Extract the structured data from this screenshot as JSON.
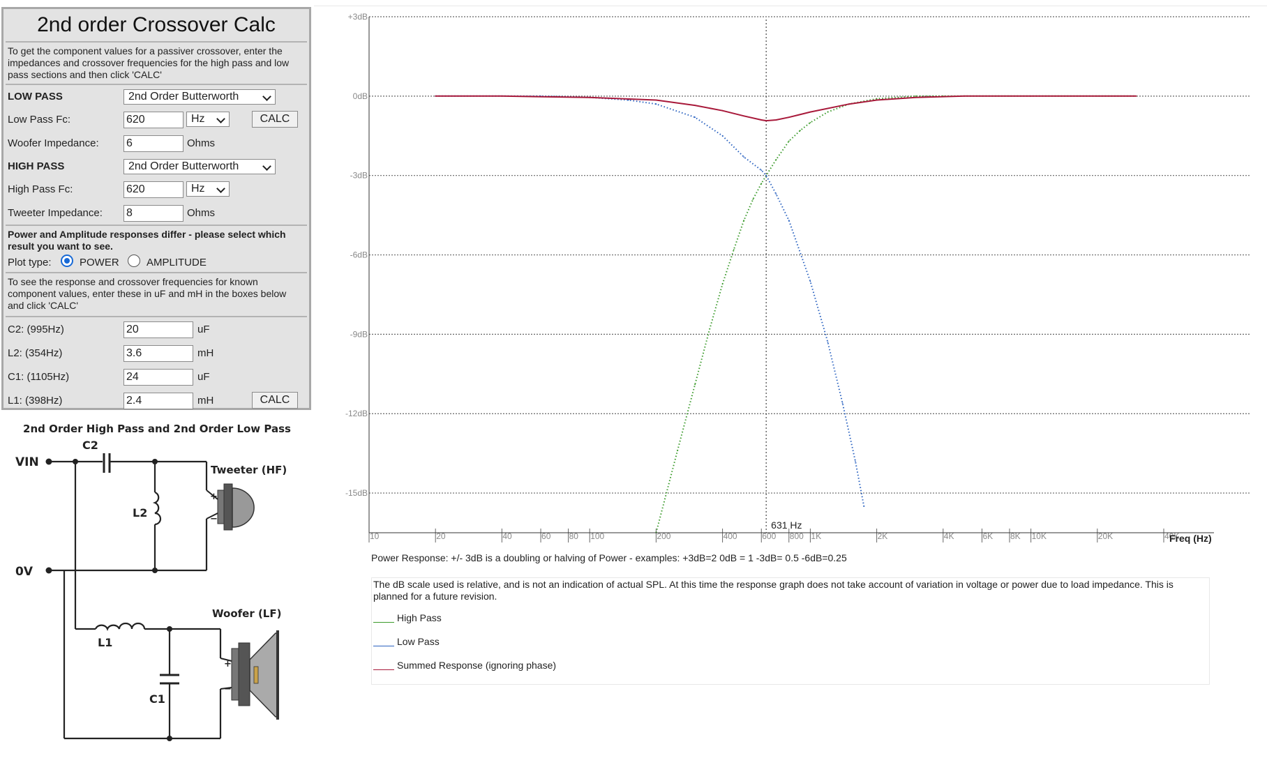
{
  "panel": {
    "title": "2nd order Crossover Calc",
    "intro": "To get the component values for a passiver crossover, enter the impedances and crossover frequencies for the high pass and low pass sections and then click 'CALC'",
    "low_pass": {
      "heading": "LOW PASS",
      "filter_type": "2nd Order Butterworth",
      "fc_label": "Low Pass Fc:",
      "fc_value": "620",
      "fc_unit": "Hz",
      "impedance_label": "Woofer Impedance:",
      "impedance_value": "6",
      "impedance_unit": "Ohms"
    },
    "high_pass": {
      "heading": "HIGH PASS",
      "filter_type": "2nd Order Butterworth",
      "fc_label": "High Pass Fc:",
      "fc_value": "620",
      "fc_unit": "Hz",
      "impedance_label": "Tweeter Impedance:",
      "impedance_value": "8",
      "impedance_unit": "Ohms"
    },
    "calc_label": "CALC",
    "response_note": "Power and Amplitude responses differ - please select which result you want to see.",
    "plot_type_label": "Plot type:",
    "plot_type_options": [
      "POWER",
      "AMPLITUDE"
    ],
    "plot_type_selected": "POWER",
    "known_values_note": "To see the response and crossover frequencies for known component values, enter these in uF and mH in the boxes below and click 'CALC'",
    "components": [
      {
        "label": "C2: (995Hz)",
        "value": "20",
        "unit": "uF"
      },
      {
        "label": "L2: (354Hz)",
        "value": "3.6",
        "unit": "mH"
      },
      {
        "label": "C1: (1105Hz)",
        "value": "24",
        "unit": "uF"
      },
      {
        "label": "L1: (398Hz)",
        "value": "2.4",
        "unit": "mH"
      }
    ]
  },
  "circuit": {
    "title": "2nd Order High Pass and 2nd Order Low Pass",
    "vin_label": "VIN",
    "ov_label": "0V",
    "tweeter_label": "Tweeter (HF)",
    "woofer_label": "Woofer (LF)",
    "c2_label": "C2",
    "l2_label": "L2",
    "l1_label": "L1",
    "c1_label": "C1",
    "plus": "+",
    "minus": "−"
  },
  "chart_data": {
    "type": "line",
    "x_scale": "log",
    "xlim": [
      10,
      40000
    ],
    "ylim": [
      -16.5,
      3
    ],
    "x_axis_label": "Freq (Hz)",
    "x_tick_labels": [
      {
        "f": 10,
        "label": "10"
      },
      {
        "f": 20,
        "label": "20"
      },
      {
        "f": 40,
        "label": "40"
      },
      {
        "f": 60,
        "label": "60"
      },
      {
        "f": 80,
        "label": "80"
      },
      {
        "f": 100,
        "label": "100"
      },
      {
        "f": 200,
        "label": "200"
      },
      {
        "f": 400,
        "label": "400"
      },
      {
        "f": 600,
        "label": "600"
      },
      {
        "f": 800,
        "label": "800"
      },
      {
        "f": 1000,
        "label": "1K"
      },
      {
        "f": 2000,
        "label": "2K"
      },
      {
        "f": 4000,
        "label": "4K"
      },
      {
        "f": 6000,
        "label": "6K"
      },
      {
        "f": 8000,
        "label": "8K"
      },
      {
        "f": 10000,
        "label": "10K"
      },
      {
        "f": 20000,
        "label": "20K"
      },
      {
        "f": 40000,
        "label": "40K"
      }
    ],
    "y_tick_labels": [
      {
        "v": 3,
        "label": "+3dB"
      },
      {
        "v": 0,
        "label": "0dB"
      },
      {
        "v": -3,
        "label": "-3dB"
      },
      {
        "v": -6,
        "label": "-6dB"
      },
      {
        "v": -9,
        "label": "-9dB"
      },
      {
        "v": -12,
        "label": "-12dB"
      },
      {
        "v": -15,
        "label": "-15dB"
      }
    ],
    "grid": "horizontal dotted",
    "crossover_marker": {
      "f": 631,
      "label": "631 Hz"
    },
    "series": [
      {
        "name": "High Pass",
        "color": "#3a9a2a",
        "x": [
          200,
          250,
          300,
          350,
          400,
          450,
          500,
          550,
          600,
          631,
          700,
          800,
          900,
          1000,
          1200,
          1500,
          2000,
          3000,
          4000,
          6000,
          8000,
          10000,
          20000,
          30000
        ],
        "y": [
          -16.5,
          -13.4,
          -10.9,
          -8.8,
          -7.1,
          -5.8,
          -4.7,
          -3.9,
          -3.3,
          -3.0,
          -2.4,
          -1.7,
          -1.3,
          -1.0,
          -0.6,
          -0.3,
          -0.1,
          0,
          0,
          0,
          0,
          0,
          0,
          0
        ]
      },
      {
        "name": "Low Pass",
        "color": "#2a62c0",
        "x": [
          20,
          40,
          60,
          100,
          150,
          200,
          300,
          400,
          500,
          600,
          631,
          700,
          800,
          1000,
          1200,
          1400,
          1600,
          1750
        ],
        "y": [
          0,
          0,
          0,
          -0.05,
          -0.15,
          -0.3,
          -0.8,
          -1.5,
          -2.3,
          -2.8,
          -3.0,
          -3.7,
          -4.7,
          -7.0,
          -9.3,
          -11.6,
          -13.8,
          -15.5
        ]
      },
      {
        "name": "Summed Response (ignoring phase)",
        "color": "#a8193a",
        "x": [
          20,
          40,
          100,
          200,
          300,
          400,
          500,
          600,
          631,
          700,
          800,
          1000,
          1500,
          2000,
          3000,
          5000,
          10000,
          30000
        ],
        "y": [
          0,
          0,
          -0.05,
          -0.15,
          -0.35,
          -0.55,
          -0.75,
          -0.9,
          -0.93,
          -0.9,
          -0.8,
          -0.6,
          -0.3,
          -0.15,
          -0.05,
          0,
          0,
          0
        ]
      }
    ]
  },
  "notes": {
    "power": "Power Response: +/- 3dB is a doubling or halving of Power - examples: +3dB=2  0dB = 1  -3dB= 0.5  -6dB=0.25",
    "disclaimer": "The dB scale used is relative, and is not an indication of actual SPL. At this time the response graph does not take account of variation in voltage or power due to load impedance. This is planned for a future revision."
  },
  "legend": [
    {
      "label": "High Pass",
      "color": "#3a9a2a"
    },
    {
      "label": "Low Pass",
      "color": "#2a62c0"
    },
    {
      "label": "Summed Response (ignoring phase)",
      "color": "#a8193a"
    }
  ]
}
